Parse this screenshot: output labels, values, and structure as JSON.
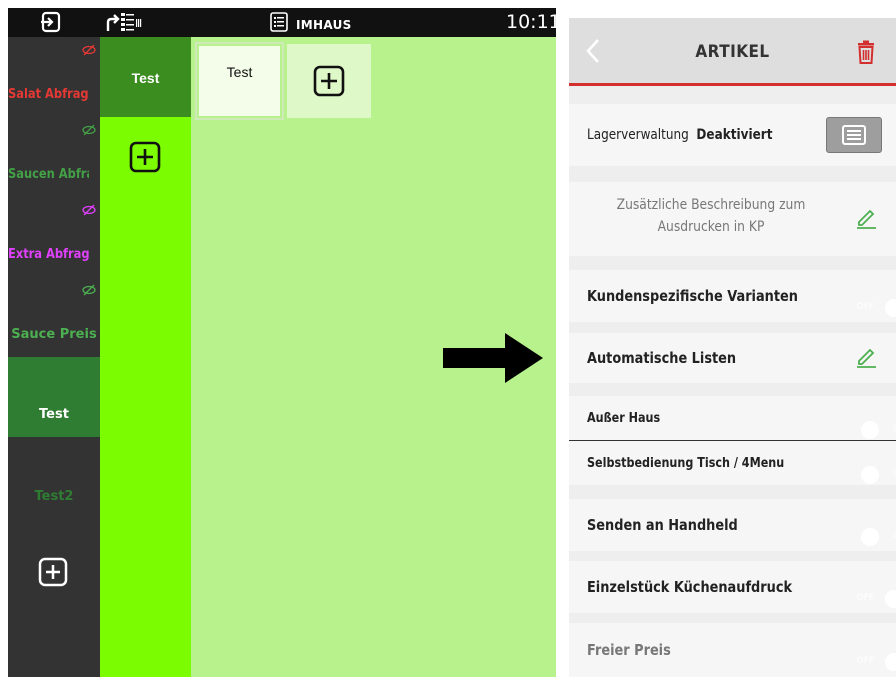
{
  "statusbar": {
    "mode_label": "IMHAUS",
    "time": "10:11"
  },
  "categories": [
    {
      "label": "Salat Abfrage",
      "color": "#e53935"
    },
    {
      "label": "Saucen Abfrage",
      "color": "#43a047"
    },
    {
      "label": "Extra Abfrage Kl",
      "color": "#e040fb"
    },
    {
      "label": "Sauce Preis",
      "color": "#4caf50"
    },
    {
      "label": "Test",
      "color": "#ffffff",
      "selected": true
    },
    {
      "label": "Test2",
      "color": "#2e7d32"
    }
  ],
  "subcategory": {
    "selected_label": "Test"
  },
  "items": {
    "card_label": "Test"
  },
  "panel": {
    "title": "ARTIKEL",
    "lager_label": "Lagerverwaltung",
    "lager_value": "Deaktiviert",
    "desc_line1": "Zusätzliche Beschreibung zum",
    "desc_line2": "Ausdrucken in KP",
    "settings": [
      {
        "label": "Kundenspezifische Varianten",
        "state": "OFF"
      },
      {
        "label": "Automatische Listen",
        "state": null
      },
      {
        "label": "Außer Haus",
        "state": "ON"
      },
      {
        "label": "Selbstbedienung Tisch / 4Menu",
        "state": "ON"
      },
      {
        "label": "Senden an Handheld",
        "state": "ON"
      },
      {
        "label": "Einzelstück Küchenaufdruck",
        "state": "OFF"
      },
      {
        "label": "Freier Preis",
        "state": "OFF"
      }
    ]
  },
  "colors": {
    "accent_red": "#d32f2f",
    "toggle_on": "#2e7d32",
    "toggle_off": "#9e9e9e",
    "bright_green": "#7cfc00",
    "light_green": "#b7f28c"
  }
}
